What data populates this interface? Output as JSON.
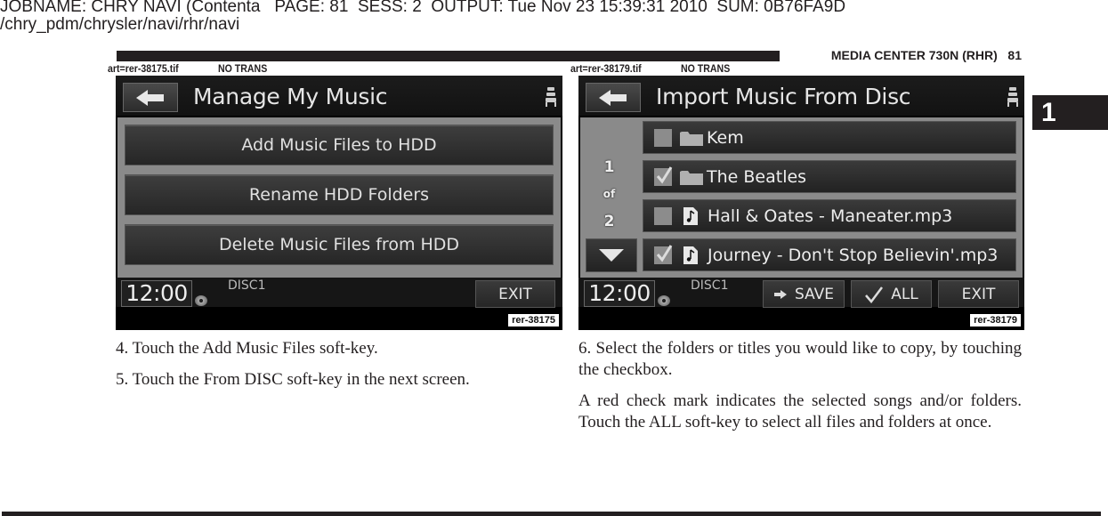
{
  "job_header": {
    "line1": "JOBNAME: CHRY NAVI (Contenta   PAGE: 81  SESS: 2  OUTPUT: Tue Nov 23 15:39:31 2010  SUM: 0B76FA9D",
    "line2": "/chry_pdm/chrysler/navi/rhr/navi"
  },
  "running_head": "MEDIA CENTER 730N (RHR)   81",
  "section_tab": "1",
  "figures": [
    {
      "art_label": "art=rer-38175.tif",
      "trans_label": "NO TRANS",
      "figure_id": "rer-38175",
      "screen": {
        "title": "Manage My Music",
        "back_icon": "arrow-left-icon",
        "seat_icon": "seat-icon",
        "menu_items": [
          {
            "label": "Add Music Files to HDD"
          },
          {
            "label": "Rename HDD Folders"
          },
          {
            "label": "Delete Music Files from HDD"
          }
        ],
        "clock": "12:00",
        "source": "DISC1",
        "soft_keys": [
          {
            "label": "EXIT"
          }
        ]
      }
    },
    {
      "art_label": "art=rer-38179.tif",
      "trans_label": "NO TRANS",
      "figure_id": "rer-38179",
      "screen": {
        "title": "Import Music From Disc",
        "back_icon": "arrow-left-icon",
        "seat_icon": "seat-icon",
        "pager": {
          "current": "1",
          "of": "of",
          "total": "2"
        },
        "items": [
          {
            "type": "folder",
            "label": "Kem",
            "checked": false
          },
          {
            "type": "folder",
            "label": "The Beatles",
            "checked": true
          },
          {
            "type": "file",
            "label": "Hall & Oates - Maneater.mp3",
            "checked": false
          },
          {
            "type": "file",
            "label": "Journey - Don't Stop Believin'.mp3",
            "checked": true
          }
        ],
        "clock": "12:00",
        "source": "DISC1",
        "soft_keys": [
          {
            "label": "SAVE",
            "icon": "arrow-right-icon"
          },
          {
            "label": "ALL",
            "icon": "checkmark-icon"
          },
          {
            "label": "EXIT"
          }
        ]
      }
    }
  ],
  "text": {
    "left_column": [
      "4.  Touch the Add Music Files soft-key.",
      "5.  Touch the From DISC soft-key in the next screen."
    ],
    "right_column": [
      "6.  Select the folders or titles you would like to copy, by touching the checkbox.",
      "A red check mark indicates the selected songs and/or folders. Touch the ALL soft-key to select all files and folders at once."
    ]
  }
}
